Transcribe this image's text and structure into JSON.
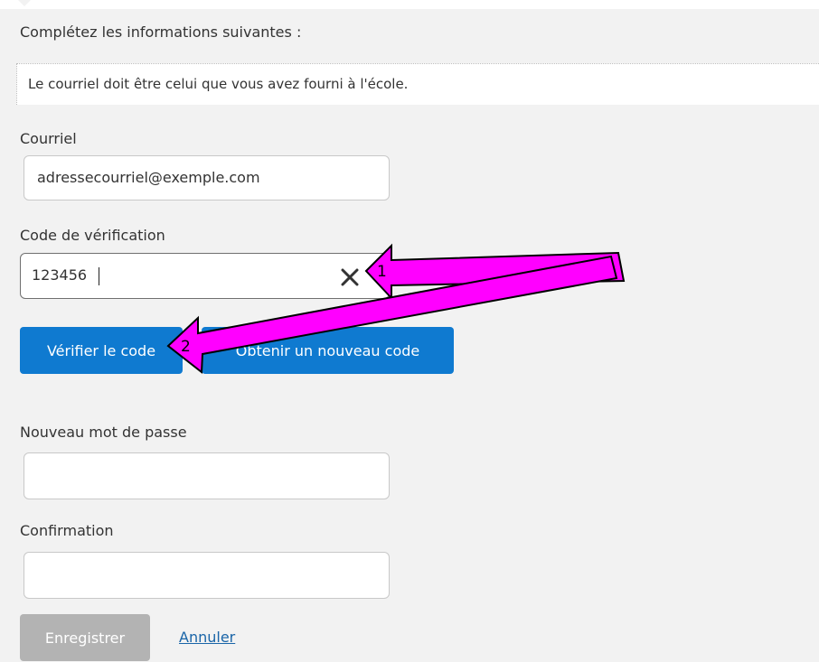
{
  "form": {
    "intro": "Complétez les informations suivantes :",
    "notice": "Le courriel doit être celui que vous avez fourni à l'école.",
    "email": {
      "label": "Courriel",
      "value": "adressecourriel@exemple.com"
    },
    "code": {
      "label": "Code de vérification",
      "value": "123456"
    },
    "buttons": {
      "verify": "Vérifier le code",
      "new_code": "Obtenir un nouveau code"
    },
    "password": {
      "label": "Nouveau mot de passe",
      "value": ""
    },
    "confirm": {
      "label": "Confirmation",
      "value": ""
    },
    "save_label": "Enregistrer",
    "cancel_label": "Annuler"
  },
  "annotations": {
    "arrow1": "1",
    "arrow2": "2",
    "color": "#ff00ff"
  },
  "colors": {
    "primary": "#0f7ad0",
    "disabled": "#b3b3b3",
    "link": "#1a65a8"
  },
  "icons": {
    "clear": "close-icon"
  }
}
